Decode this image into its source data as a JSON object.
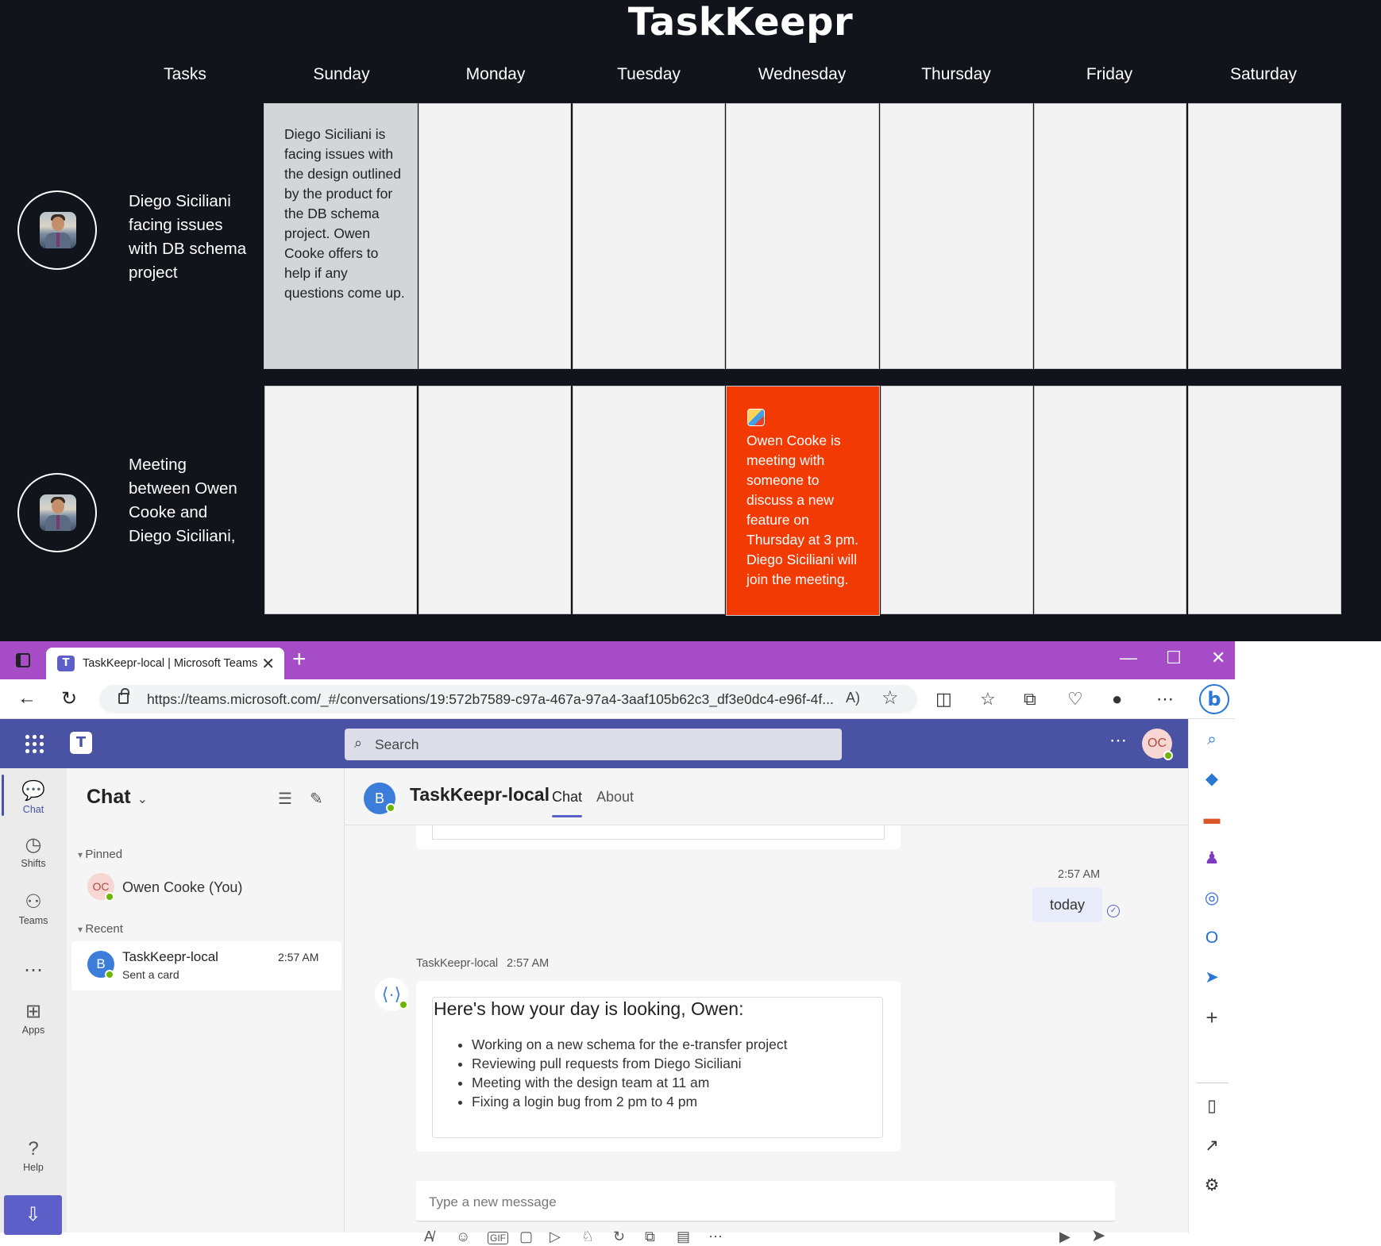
{
  "taskkeepr": {
    "title": "TaskKeepr",
    "headers": [
      "Tasks",
      "Sunday",
      "Monday",
      "Tuesday",
      "Wednesday",
      "Thursday",
      "Friday",
      "Saturday"
    ],
    "tasks": [
      {
        "label": "Diego Siciliani facing issues with DB schema project",
        "cells": [
          "Diego Siciliani is facing issues with the design outlined by the product for the DB schema project. Owen Cooke offers to help if any questions come up.",
          "",
          "",
          "",
          "",
          "",
          ""
        ]
      },
      {
        "label": "Meeting between Owen Cooke and Diego Siciliani,",
        "cells": [
          "",
          "",
          "",
          "Owen Cooke is meeting with someone to discuss a new feature on Thursday at 3 pm. Diego Siciliani will join the meeting.",
          "",
          "",
          ""
        ]
      }
    ],
    "colors": {
      "background": "#11141a",
      "highlight_gray": "#d3d5d8",
      "highlight_red": "#f23a05"
    }
  },
  "browser": {
    "tab_title": "TaskKeepr-local | Microsoft Teams",
    "url": "https://teams.microsoft.com/_#/conversations/19:572b7589-c97a-467a-97a4-3aaf105b62c3_df3e0dc4-e96f-4f...",
    "tab_close": "✕",
    "new_tab": "+",
    "window_controls": [
      "—",
      "☐",
      "✕"
    ],
    "accent": "#a64cc6"
  },
  "teams": {
    "search_placeholder": "Search",
    "me_initials": "OC",
    "rail": [
      {
        "label": "Chat",
        "icon": "chat-icon"
      },
      {
        "label": "Shifts",
        "icon": "shifts-icon"
      },
      {
        "label": "Teams",
        "icon": "teams-icon"
      },
      {
        "label": "",
        "icon": "more-icon"
      },
      {
        "label": "Apps",
        "icon": "apps-icon"
      },
      {
        "label": "Help",
        "icon": "help-icon"
      }
    ],
    "chat_header": "Chat",
    "pinned_label": "Pinned",
    "recent_label": "Recent",
    "pinned": [
      {
        "initials": "OC",
        "name": "Owen Cooke (You)"
      }
    ],
    "recent": [
      {
        "initials": "B",
        "name": "TaskKeepr-local",
        "preview": "Sent a card",
        "time": "2:57 AM"
      }
    ],
    "conversation": {
      "title": "TaskKeepr-local",
      "avatar": "B",
      "tabs": [
        "Chat",
        "About"
      ],
      "my_time": "2:57 AM",
      "my_message": "today",
      "bot_sender": "TaskKeepr-local",
      "bot_time": "2:57 AM",
      "card_title": "Here's how your day is looking, Owen:",
      "card_items": [
        "Working on a new schema for the e-transfer project",
        "Reviewing pull requests from Diego Siciliani",
        "Meeting with the design team at 11 am",
        "Fixing a login bug from 2 pm to 4 pm"
      ],
      "compose_placeholder": "Type a new message"
    },
    "brand": "#4a52a3"
  }
}
